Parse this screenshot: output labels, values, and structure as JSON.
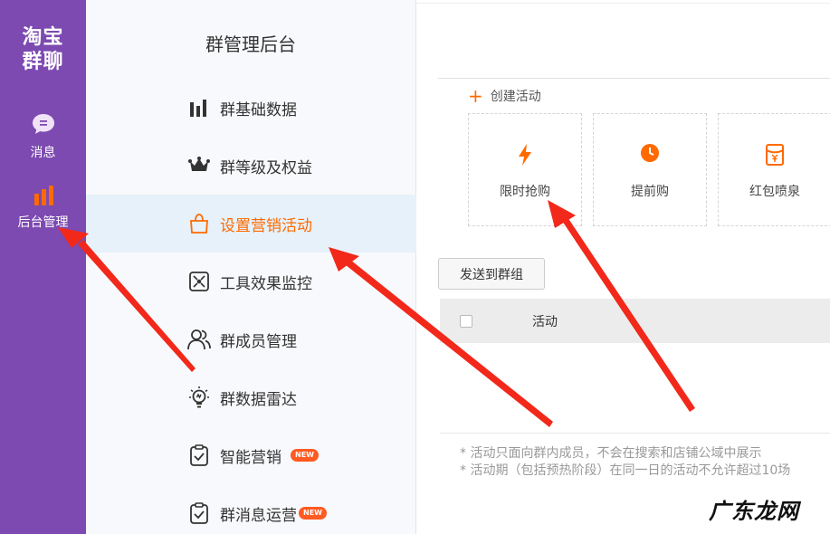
{
  "rail": {
    "logo_line1": "淘宝",
    "logo_line2": "群聊",
    "items": [
      {
        "label": "消息",
        "icon": "chat-bubble-icon"
      },
      {
        "label": "后台管理",
        "icon": "bar-chart-icon"
      }
    ]
  },
  "menu": {
    "title": "群管理后台",
    "items": [
      {
        "label": "群基础数据",
        "icon": "bar-chart-icon"
      },
      {
        "label": "群等级及权益",
        "icon": "crown-icon"
      },
      {
        "label": "设置营销活动",
        "icon": "shopping-bag-icon",
        "active": true
      },
      {
        "label": "工具效果监控",
        "icon": "monitor-icon"
      },
      {
        "label": "群成员管理",
        "icon": "members-icon"
      },
      {
        "label": "群数据雷达",
        "icon": "lightbulb-icon"
      },
      {
        "label": "智能营销",
        "icon": "clipboard-check-icon",
        "badge": "NEW"
      },
      {
        "label": "群消息运营",
        "icon": "clipboard-check-icon",
        "badge": "NEW"
      }
    ]
  },
  "main": {
    "create_label": "创建活动",
    "cards": [
      {
        "label": "限时抢购",
        "icon": "lightning-icon"
      },
      {
        "label": "提前购",
        "icon": "clock-icon"
      },
      {
        "label": "红包喷泉",
        "icon": "red-packet-icon"
      }
    ],
    "send_button": "发送到群组",
    "table": {
      "columns": [
        "活动"
      ]
    },
    "notes": [
      "* 活动只面向群内成员，不会在搜索和店铺公域中展示",
      "* 活动期（包括预热阶段）在同一日的活动不允许超过10场"
    ]
  },
  "watermark": "广东龙网",
  "colors": {
    "rail": "#7c4ab0",
    "accent": "#ff6a00",
    "active_bg": "#e6f1fa",
    "arrow": "#f2281b"
  }
}
